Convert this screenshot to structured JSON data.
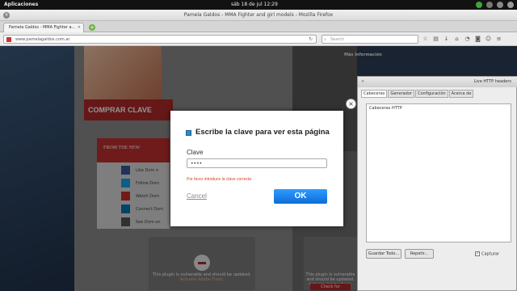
{
  "system_bar": {
    "apps_label": "Aplicaciones",
    "clock": "sáb 18 de jul   12:29"
  },
  "window": {
    "title": "Pamela Galdos - MMA Fighter and girl models - Mozilla Firefox"
  },
  "browser": {
    "tab_title": "Pamela Galdos - MMA Fighter a...",
    "url": "www.pamelagaldos.com.ar",
    "search_placeholder": "Search"
  },
  "page": {
    "buy_button": "COMPRAR CLAVE",
    "news_ribbon": "FROM THE NEW",
    "social": [
      "Like Dom o",
      "Follow Dom",
      "Watch Dom",
      "Connect Dom",
      "See Dom on"
    ],
    "sidebar_title": "Más Información",
    "plugin_msg": "This plugin is vulnerable and should be updated.",
    "plugin_link": "Activate Adobe Flash.",
    "plugin_button": "Check for updates..."
  },
  "dialog": {
    "title": "Escribe la clave para ver esta página",
    "label": "Clave",
    "value": "••••",
    "error": "Por favor introduce la clave correcta",
    "cancel": "Cancel",
    "ok": "OK"
  },
  "live_http": {
    "title": "Live HTTP headers",
    "tabs": [
      "Cabeceras",
      "Generador",
      "Configuración",
      "Acerca de"
    ],
    "header": "Cabeceras HTTP",
    "save_button": "Guardar Todo...",
    "repeat_button": "Repetir...",
    "capture_label": "Capturar"
  },
  "colors": {
    "accent_ok": "#1a82ea",
    "error": "#d0451b",
    "brand_red": "#b02828"
  }
}
